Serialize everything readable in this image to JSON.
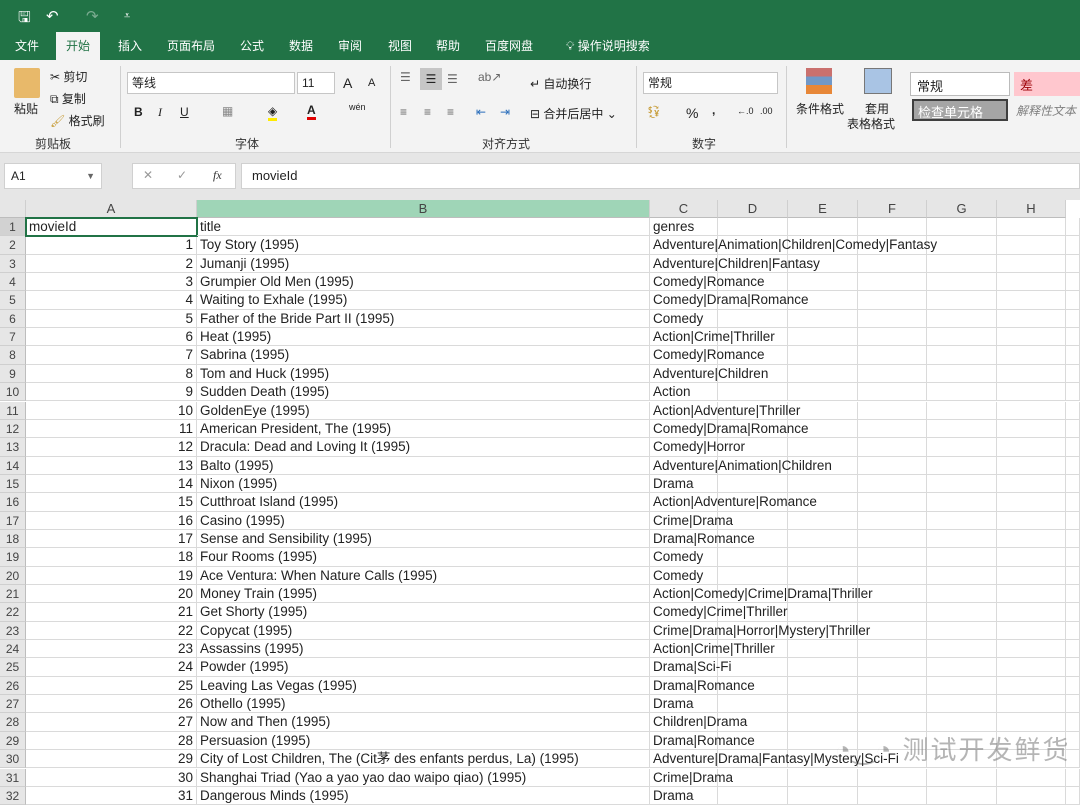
{
  "quick_access": {
    "save": "🖫",
    "undo": "↶",
    "redo": "↷",
    "more": "⩡"
  },
  "tabs": [
    "文件",
    "开始",
    "插入",
    "页面布局",
    "公式",
    "数据",
    "审阅",
    "视图",
    "帮助",
    "百度网盘"
  ],
  "active_tab": "开始",
  "tell_me": "操作说明搜索",
  "ribbon": {
    "clipboard": {
      "paste": "粘贴",
      "cut": "剪切",
      "copy": "复制",
      "format_painter": "格式刷",
      "label": "剪贴板"
    },
    "font": {
      "name": "等线",
      "size": "11",
      "bold": "B",
      "italic": "I",
      "underline": "U",
      "phonetic": "wén",
      "label": "字体"
    },
    "alignment": {
      "wrap": "自动换行",
      "merge": "合并后居中",
      "label": "对齐方式"
    },
    "number": {
      "format": "常规",
      "percent": "%",
      "comma": ",",
      "label": "数字"
    },
    "styles": {
      "conditional": "条件格式",
      "table_format_1": "套用",
      "table_format_2": "表格格式",
      "normal": "常规",
      "bad": "差",
      "check_cell": "检查单元格",
      "explanatory": "解释性文本"
    }
  },
  "colors": {
    "brand": "#217346",
    "selected_col": "#9fd5b7"
  },
  "name_box": "A1",
  "formula": "movieId",
  "columns": [
    "A",
    "B",
    "C",
    "D",
    "E",
    "F",
    "G",
    "H"
  ],
  "header_row": [
    "movieId",
    "title",
    "genres"
  ],
  "rows": [
    [
      "1",
      "Toy Story (1995)",
      "Adventure|Animation|Children|Comedy|Fantasy"
    ],
    [
      "2",
      "Jumanji (1995)",
      "Adventure|Children|Fantasy"
    ],
    [
      "3",
      "Grumpier Old Men (1995)",
      "Comedy|Romance"
    ],
    [
      "4",
      "Waiting to Exhale (1995)",
      "Comedy|Drama|Romance"
    ],
    [
      "5",
      "Father of the Bride Part II (1995)",
      "Comedy"
    ],
    [
      "6",
      "Heat (1995)",
      "Action|Crime|Thriller"
    ],
    [
      "7",
      "Sabrina (1995)",
      "Comedy|Romance"
    ],
    [
      "8",
      "Tom and Huck (1995)",
      "Adventure|Children"
    ],
    [
      "9",
      "Sudden Death (1995)",
      "Action"
    ],
    [
      "10",
      "GoldenEye (1995)",
      "Action|Adventure|Thriller"
    ],
    [
      "11",
      "American President, The (1995)",
      "Comedy|Drama|Romance"
    ],
    [
      "12",
      "Dracula: Dead and Loving It (1995)",
      "Comedy|Horror"
    ],
    [
      "13",
      "Balto (1995)",
      "Adventure|Animation|Children"
    ],
    [
      "14",
      "Nixon (1995)",
      "Drama"
    ],
    [
      "15",
      "Cutthroat Island (1995)",
      "Action|Adventure|Romance"
    ],
    [
      "16",
      "Casino (1995)",
      "Crime|Drama"
    ],
    [
      "17",
      "Sense and Sensibility (1995)",
      "Drama|Romance"
    ],
    [
      "18",
      "Four Rooms (1995)",
      "Comedy"
    ],
    [
      "19",
      "Ace Ventura: When Nature Calls (1995)",
      "Comedy"
    ],
    [
      "20",
      "Money Train (1995)",
      "Action|Comedy|Crime|Drama|Thriller"
    ],
    [
      "21",
      "Get Shorty (1995)",
      "Comedy|Crime|Thriller"
    ],
    [
      "22",
      "Copycat (1995)",
      "Crime|Drama|Horror|Mystery|Thriller"
    ],
    [
      "23",
      "Assassins (1995)",
      "Action|Crime|Thriller"
    ],
    [
      "24",
      "Powder (1995)",
      "Drama|Sci-Fi"
    ],
    [
      "25",
      "Leaving Las Vegas (1995)",
      "Drama|Romance"
    ],
    [
      "26",
      "Othello (1995)",
      "Drama"
    ],
    [
      "27",
      "Now and Then (1995)",
      "Children|Drama"
    ],
    [
      "28",
      "Persuasion (1995)",
      "Drama|Romance"
    ],
    [
      "29",
      "City of Lost Children, The (Cit茅 des enfants perdus, La) (1995)",
      "Adventure|Drama|Fantasy|Mystery|Sci-Fi"
    ],
    [
      "30",
      "Shanghai Triad (Yao a yao yao dao waipo qiao) (1995)",
      "Crime|Drama"
    ],
    [
      "31",
      "Dangerous Minds (1995)",
      "Drama"
    ]
  ],
  "watermark": "测试开发鲜货"
}
